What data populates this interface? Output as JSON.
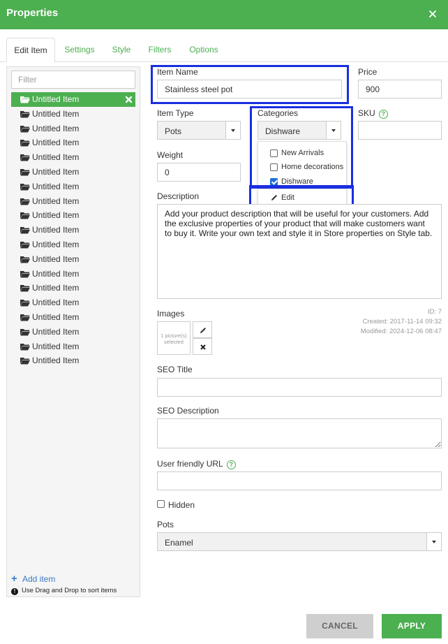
{
  "header": {
    "title": "Properties",
    "close_icon": "close-icon"
  },
  "tabs": [
    {
      "label": "Edit Item",
      "active": true
    },
    {
      "label": "Settings",
      "active": false
    },
    {
      "label": "Style",
      "active": false
    },
    {
      "label": "Filters",
      "active": false
    },
    {
      "label": "Options",
      "active": false
    }
  ],
  "sidebar": {
    "filter_placeholder": "Filter",
    "items": [
      "Untitled Item",
      "Untitled Item",
      "Untitled Item",
      "Untitled Item",
      "Untitled Item",
      "Untitled Item",
      "Untitled Item",
      "Untitled Item",
      "Untitled Item",
      "Untitled Item",
      "Untitled Item",
      "Untitled Item",
      "Untitled Item",
      "Untitled Item",
      "Untitled Item",
      "Untitled Item",
      "Untitled Item",
      "Untitled Item",
      "Untitled Item"
    ],
    "selected_index": 0,
    "add_label": "Add item",
    "hint": "Use Drag and Drop to sort items"
  },
  "form": {
    "item_name": {
      "label": "Item Name",
      "value": "Stainless steel pot"
    },
    "price": {
      "label": "Price",
      "value": "900"
    },
    "item_type": {
      "label": "Item Type",
      "value": "Pots"
    },
    "categories": {
      "label": "Categories",
      "value": "Dishware",
      "options": [
        {
          "label": "New Arrivals",
          "checked": false
        },
        {
          "label": "Home decorations",
          "checked": false
        },
        {
          "label": "Dishware",
          "checked": true
        }
      ],
      "edit_label": "Edit"
    },
    "sku": {
      "label": "SKU",
      "value": ""
    },
    "weight": {
      "label": "Weight",
      "value": "0"
    },
    "description": {
      "label": "Description",
      "value": "Add your product description that will be useful for your customers. Add the exclusive properties of your product that will make customers want to buy it. Write your own text and style it in Store properties on Style tab."
    },
    "images": {
      "label": "Images",
      "placeholder": "1 picture(s) selected",
      "id": "ID: 7",
      "created": "Created: 2017-11-14 09:32",
      "modified": "Modified: 2024-12-06 08:47"
    },
    "seo_title": {
      "label": "SEO Title",
      "value": ""
    },
    "seo_description": {
      "label": "SEO Description",
      "value": ""
    },
    "url": {
      "label": "User friendly URL",
      "value": ""
    },
    "hidden": {
      "label": "Hidden",
      "checked": false
    },
    "pots": {
      "label": "Pots",
      "value": "Enamel"
    }
  },
  "footer": {
    "cancel_label": "CANCEL",
    "apply_label": "APPLY"
  },
  "colors": {
    "brand": "#4caf50",
    "highlight": "#1a2ee0",
    "link": "#3a78c3"
  }
}
